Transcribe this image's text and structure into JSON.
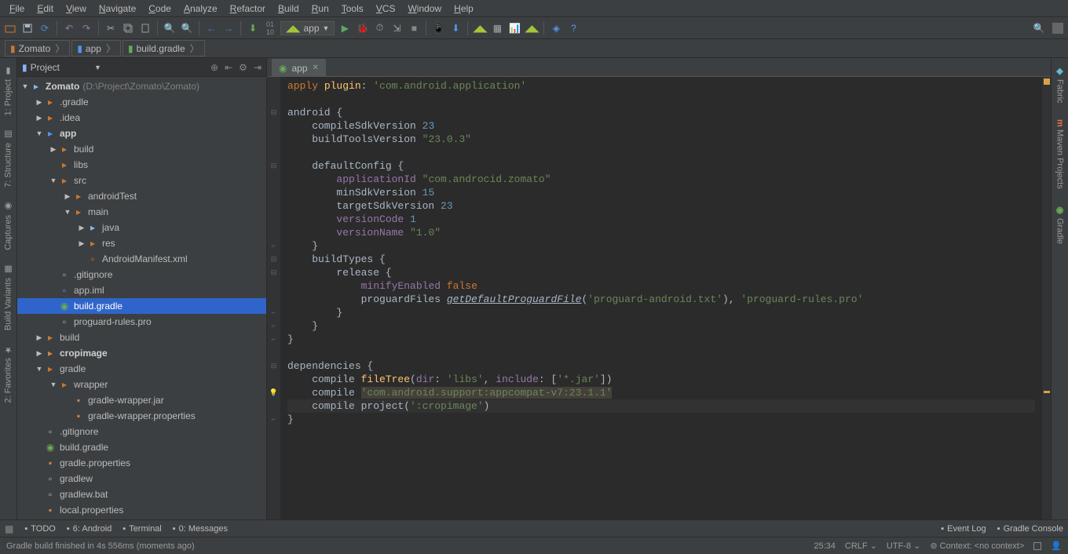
{
  "menu": [
    "File",
    "Edit",
    "View",
    "Navigate",
    "Code",
    "Analyze",
    "Refactor",
    "Build",
    "Run",
    "Tools",
    "VCS",
    "Window",
    "Help"
  ],
  "run_target": "app",
  "breadcrumb": [
    {
      "icon": "folder",
      "label": "Zomato"
    },
    {
      "icon": "module",
      "label": "app"
    },
    {
      "icon": "gradle",
      "label": "build.gradle"
    }
  ],
  "left_tabs": [
    {
      "label": "1: Project",
      "icon": "project"
    },
    {
      "label": "7: Structure",
      "icon": "structure"
    },
    {
      "label": "Captures",
      "icon": "captures"
    },
    {
      "label": "Build Variants",
      "icon": "variants"
    },
    {
      "label": "2: Favorites",
      "icon": "favorites"
    }
  ],
  "right_tabs": [
    {
      "label": "Fabric",
      "icon": "fabric"
    },
    {
      "label": "Maven Projects",
      "icon": "maven"
    },
    {
      "label": "Gradle",
      "icon": "gradle"
    }
  ],
  "project_header": {
    "label": "Project"
  },
  "tree": [
    {
      "d": 0,
      "tw": "▼",
      "icon": "folder-b",
      "name": "Zomato",
      "sub": "(D:\\Project\\Zomato\\Zomato)",
      "bold": true
    },
    {
      "d": 1,
      "tw": "▶",
      "icon": "folder",
      "name": ".gradle"
    },
    {
      "d": 1,
      "tw": "▶",
      "icon": "folder",
      "name": ".idea"
    },
    {
      "d": 1,
      "tw": "▼",
      "icon": "module",
      "name": "app",
      "bold": true
    },
    {
      "d": 2,
      "tw": "▶",
      "icon": "folder",
      "name": "build"
    },
    {
      "d": 2,
      "tw": "",
      "icon": "folder",
      "name": "libs"
    },
    {
      "d": 2,
      "tw": "▼",
      "icon": "folder",
      "name": "src"
    },
    {
      "d": 3,
      "tw": "▶",
      "icon": "folder",
      "name": "androidTest"
    },
    {
      "d": 3,
      "tw": "▼",
      "icon": "folder",
      "name": "main"
    },
    {
      "d": 4,
      "tw": "▶",
      "icon": "folder-b",
      "name": "java"
    },
    {
      "d": 4,
      "tw": "▶",
      "icon": "folder-res",
      "name": "res"
    },
    {
      "d": 4,
      "tw": "",
      "icon": "xml",
      "name": "AndroidManifest.xml"
    },
    {
      "d": 2,
      "tw": "",
      "icon": "file",
      "name": ".gitignore"
    },
    {
      "d": 2,
      "tw": "",
      "icon": "iml",
      "name": "app.iml"
    },
    {
      "d": 2,
      "tw": "",
      "icon": "gradle",
      "name": "build.gradle",
      "selected": true
    },
    {
      "d": 2,
      "tw": "",
      "icon": "file",
      "name": "proguard-rules.pro"
    },
    {
      "d": 1,
      "tw": "▶",
      "icon": "folder",
      "name": "build"
    },
    {
      "d": 1,
      "tw": "▶",
      "icon": "module-o",
      "name": "cropimage",
      "bold": true
    },
    {
      "d": 1,
      "tw": "▼",
      "icon": "folder",
      "name": "gradle"
    },
    {
      "d": 2,
      "tw": "▼",
      "icon": "folder",
      "name": "wrapper"
    },
    {
      "d": 3,
      "tw": "",
      "icon": "jar",
      "name": "gradle-wrapper.jar"
    },
    {
      "d": 3,
      "tw": "",
      "icon": "props",
      "name": "gradle-wrapper.properties"
    },
    {
      "d": 1,
      "tw": "",
      "icon": "file",
      "name": ".gitignore"
    },
    {
      "d": 1,
      "tw": "",
      "icon": "gradle",
      "name": "build.gradle"
    },
    {
      "d": 1,
      "tw": "",
      "icon": "props",
      "name": "gradle.properties"
    },
    {
      "d": 1,
      "tw": "",
      "icon": "file",
      "name": "gradlew"
    },
    {
      "d": 1,
      "tw": "",
      "icon": "file",
      "name": "gradlew.bat"
    },
    {
      "d": 1,
      "tw": "",
      "icon": "props",
      "name": "local.properties"
    }
  ],
  "editor_tab": {
    "label": "app",
    "icon": "gradle"
  },
  "code_lines": [
    [
      [
        "kw",
        "apply "
      ],
      [
        "fn",
        "plugin"
      ],
      [
        "",
        ":"
      ],
      [
        "",
        " "
      ],
      [
        "str",
        "'com.android.application'"
      ]
    ],
    [],
    [
      [
        "",
        "android "
      ],
      [
        "",
        "{"
      ]
    ],
    [
      [
        "",
        "    compileSdkVersion "
      ],
      [
        "num",
        "23"
      ]
    ],
    [
      [
        "",
        "    buildToolsVersion "
      ],
      [
        "str",
        "\"23.0.3\""
      ]
    ],
    [],
    [
      [
        "",
        "    defaultConfig "
      ],
      [
        "",
        "{"
      ]
    ],
    [
      [
        "",
        "        "
      ],
      [
        "ident",
        "applicationId"
      ],
      [
        "",
        " "
      ],
      [
        "str",
        "\"com.androcid.zomato\""
      ]
    ],
    [
      [
        "",
        "        minSdkVersion "
      ],
      [
        "num",
        "15"
      ]
    ],
    [
      [
        "",
        "        targetSdkVersion "
      ],
      [
        "num",
        "23"
      ]
    ],
    [
      [
        "",
        "        "
      ],
      [
        "ident",
        "versionCode"
      ],
      [
        "",
        " "
      ],
      [
        "num",
        "1"
      ]
    ],
    [
      [
        "",
        "        "
      ],
      [
        "ident",
        "versionName"
      ],
      [
        "",
        " "
      ],
      [
        "str",
        "\"1.0\""
      ]
    ],
    [
      [
        "",
        "    }"
      ]
    ],
    [
      [
        "",
        "    buildTypes "
      ],
      [
        "",
        "{"
      ]
    ],
    [
      [
        "",
        "        release "
      ],
      [
        "",
        "{"
      ]
    ],
    [
      [
        "",
        "            "
      ],
      [
        "ident",
        "minifyEnabled"
      ],
      [
        "",
        " "
      ],
      [
        "kw",
        "false"
      ]
    ],
    [
      [
        "",
        "            proguardFiles "
      ],
      [
        "underline",
        "getDefaultProguardFile"
      ],
      [
        "",
        "("
      ],
      [
        "str",
        "'proguard-android.txt'"
      ],
      [
        "",
        ")"
      ],
      [
        "",
        ", "
      ],
      [
        "str",
        "'proguard-rules.pro'"
      ]
    ],
    [
      [
        "",
        "        }"
      ]
    ],
    [
      [
        "",
        "    }"
      ]
    ],
    [
      [
        "",
        "}"
      ]
    ],
    [],
    [
      [
        "",
        "dependencies "
      ],
      [
        "",
        "{"
      ]
    ],
    [
      [
        "",
        "    compile "
      ],
      [
        "fn",
        "fileTree"
      ],
      [
        "",
        "("
      ],
      [
        "ident",
        "dir"
      ],
      [
        "",
        ": "
      ],
      [
        "str",
        "'libs'"
      ],
      [
        "",
        ", "
      ],
      [
        "ident",
        "include"
      ],
      [
        "",
        ": ["
      ],
      [
        "str",
        "'*.jar'"
      ],
      [
        "",
        "])"
      ]
    ],
    [
      [
        "",
        "    compile "
      ],
      [
        "hl",
        "'com.android.support:appcompat-v7:23.1.1'"
      ]
    ],
    [
      [
        "",
        "    compile project("
      ],
      [
        "str",
        "':cropimage'"
      ],
      [
        "",
        ")"
      ]
    ],
    [
      [
        "",
        "}"
      ]
    ]
  ],
  "caret_line_index": 24,
  "bulb_line_index": 23,
  "bottom_tabs": [
    {
      "icon": "todo",
      "label": "TODO"
    },
    {
      "icon": "android",
      "label": "6: Android"
    },
    {
      "icon": "terminal",
      "label": "Terminal"
    },
    {
      "icon": "messages",
      "label": "0: Messages"
    }
  ],
  "bottom_right_tabs": [
    {
      "icon": "event",
      "label": "Event Log"
    },
    {
      "icon": "gradle-console",
      "label": "Gradle Console"
    }
  ],
  "status_left": "Gradle build finished in 4s 556ms (moments ago)",
  "status_right": {
    "pos": "25:34",
    "crlf": "CRLF",
    "enc": "UTF-8",
    "context": "Context: <no context>"
  }
}
